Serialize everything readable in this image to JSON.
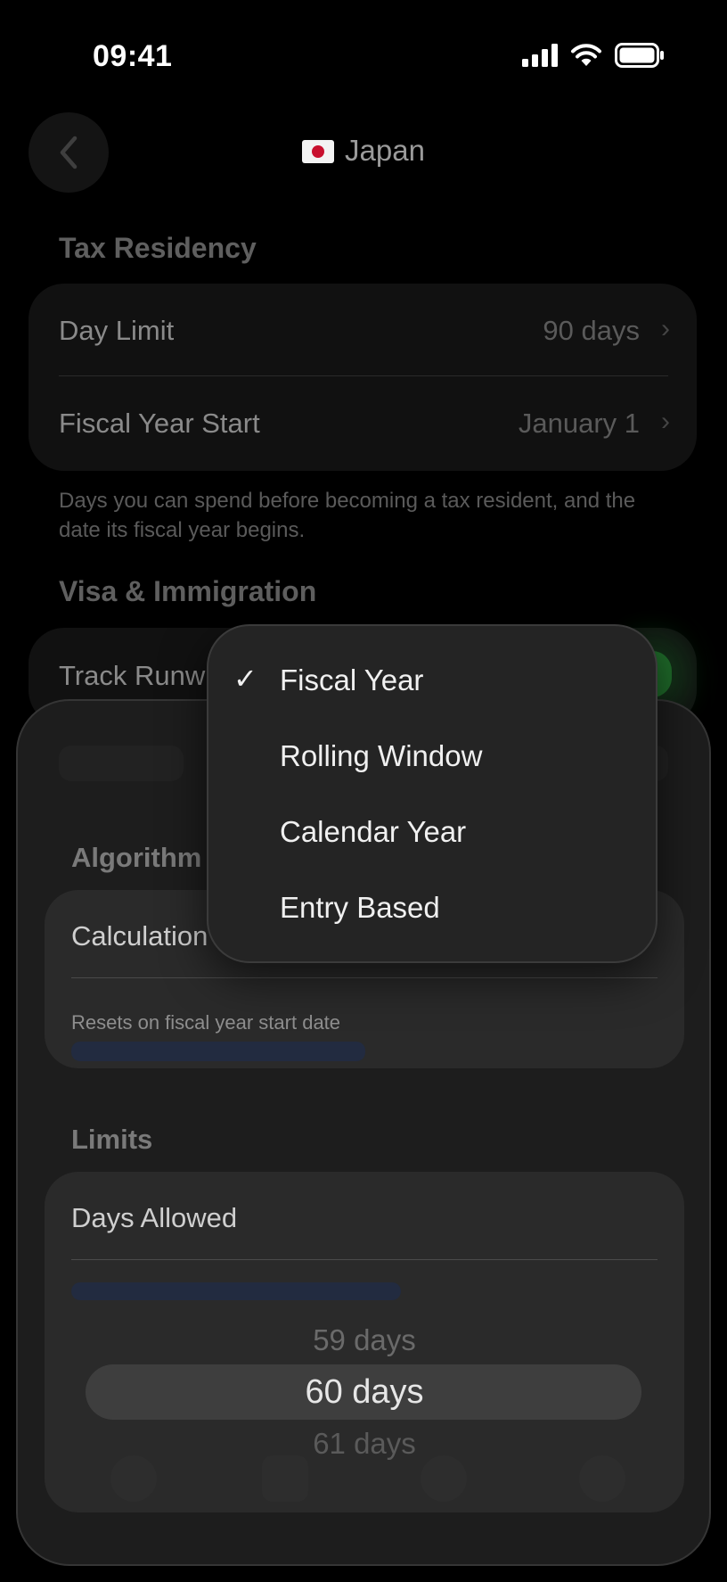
{
  "status": {
    "time": "09:41"
  },
  "nav": {
    "title": "Japan",
    "flag_icon": "japan-flag"
  },
  "tax_residency": {
    "header": "Tax Residency",
    "rows": [
      {
        "label": "Day Limit",
        "value": "90 days"
      },
      {
        "label": "Fiscal Year Start",
        "value": "January 1"
      }
    ],
    "footnote": "Days you can spend before becoming a tax resident, and the date its fiscal year begins."
  },
  "visa": {
    "header": "Visa & Immigration",
    "track_label": "Track Runw",
    "track_enabled": true
  },
  "sheet": {
    "algorithm_header": "Algorithm",
    "calculation_label": "Calculation",
    "calculation_note": "Resets on fiscal year start date",
    "limits_header": "Limits",
    "days_allowed_label": "Days Allowed",
    "picker": {
      "prev": "59 days",
      "selected": "60 days",
      "next": "61 days"
    }
  },
  "menu": {
    "items": [
      {
        "label": "Fiscal Year",
        "checked": "✓"
      },
      {
        "label": "Rolling Window"
      },
      {
        "label": "Calendar Year"
      },
      {
        "label": "Entry Based"
      }
    ]
  },
  "colors": {
    "accent_green": "#1f6a2a",
    "sheet_bg": "#1d1d1d",
    "menu_bg": "#242424"
  }
}
